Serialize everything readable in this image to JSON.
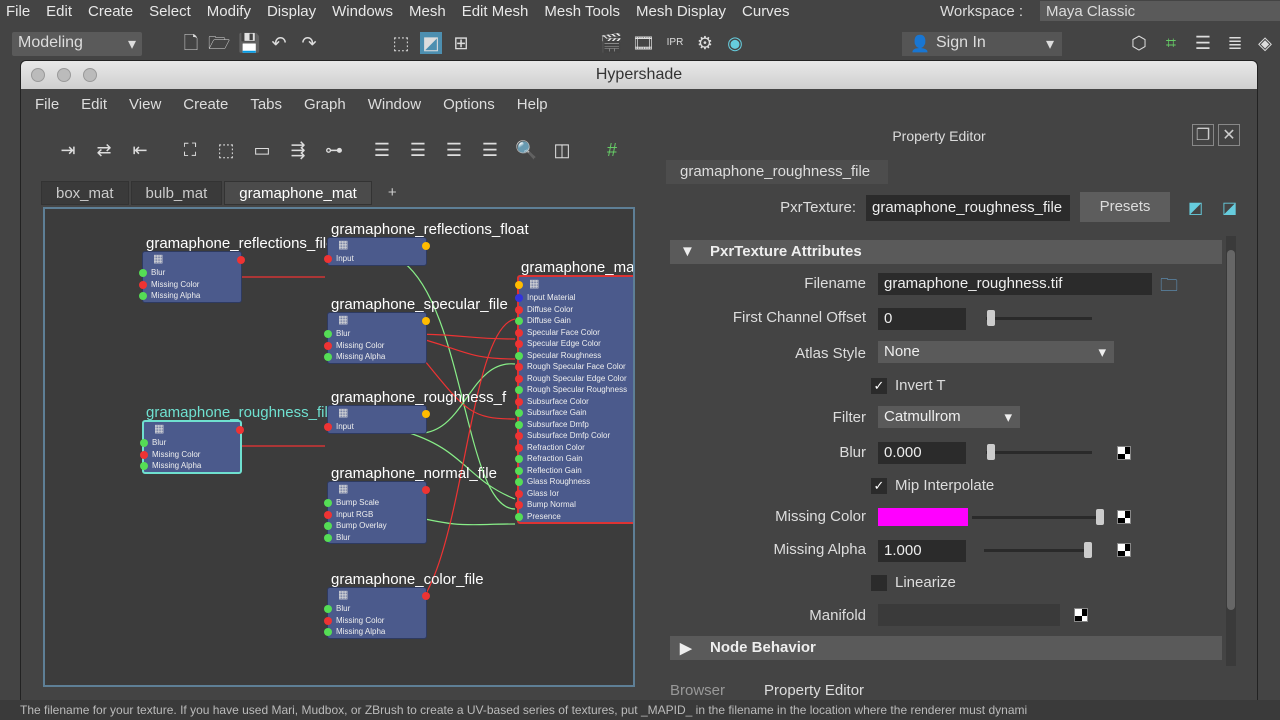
{
  "menubar": [
    "File",
    "Edit",
    "Create",
    "Select",
    "Modify",
    "Display",
    "Windows",
    "Mesh",
    "Edit Mesh",
    "Mesh Tools",
    "Mesh Display",
    "Curves"
  ],
  "workspace": {
    "label": "Workspace :",
    "value": "Maya Classic"
  },
  "toolbar": {
    "mode": "Modeling",
    "sign_in": "Sign In"
  },
  "hypershade": {
    "title": "Hypershade",
    "menu": [
      "File",
      "Edit",
      "View",
      "Create",
      "Tabs",
      "Graph",
      "Window",
      "Options",
      "Help"
    ],
    "tabs": [
      "box_mat",
      "bulb_mat",
      "gramaphone_mat",
      "+"
    ],
    "active_tab": 2,
    "nodes": {
      "reflections_file": {
        "title": "gramaphone_reflections_file",
        "rows": [
          "Blur",
          "Missing Color",
          "Missing Alpha"
        ]
      },
      "reflections_float": {
        "title": "gramaphone_reflections_float",
        "rows": [
          "Input"
        ]
      },
      "specular_file": {
        "title": "gramaphone_specular_file",
        "rows": [
          "Blur",
          "Missing Color",
          "Missing Alpha"
        ]
      },
      "roughness_file": {
        "title": "gramaphone_roughness_file",
        "rows": [
          "Blur",
          "Missing Color",
          "Missing Alpha"
        ]
      },
      "roughness_float": {
        "title": "gramaphone_roughness_f",
        "rows": [
          "Input"
        ]
      },
      "normal_file": {
        "title": "gramaphone_normal_file",
        "rows": [
          "Bump Scale",
          "Input RGB",
          "Bump Overlay",
          "Blur"
        ]
      },
      "color_file": {
        "title": "gramaphone_color_file",
        "rows": [
          "Blur",
          "Missing Color",
          "Missing Alpha"
        ]
      },
      "material": {
        "title": "gramaphone_ma",
        "rows": [
          "Input Material",
          "Diffuse Color",
          "Diffuse Gain",
          "Specular Face Color",
          "Specular Edge Color",
          "Specular Roughness",
          "Rough Specular Face Color",
          "Rough Specular Edge Color",
          "Rough Specular Roughness",
          "Subsurface Color",
          "Subsurface Gain",
          "Subsurface Dmfp",
          "Subsurface Dmfp Color",
          "Refraction Color",
          "Refraction Gain",
          "Reflection Gain",
          "Glass Roughness",
          "Glass Ior",
          "Bump Normal",
          "Presence"
        ]
      }
    },
    "selected_color": "#6fe0d0"
  },
  "property_editor": {
    "title": "Property Editor",
    "node_tab": "gramaphone_roughness_file",
    "type_label": "PxrTexture:",
    "type_value": "gramaphone_roughness_file",
    "presets": "Presets",
    "section": "PxrTexture Attributes",
    "filename_label": "Filename",
    "filename": "gramaphone_roughness.tif",
    "first_channel_label": "First Channel Offset",
    "first_channel": "0",
    "atlas_label": "Atlas Style",
    "atlas": "None",
    "invert_t": "Invert T",
    "invert_t_checked": true,
    "filter_label": "Filter",
    "filter": "Catmullrom",
    "blur_label": "Blur",
    "blur": "0.000",
    "mip_label": "Mip Interpolate",
    "mip_checked": true,
    "missing_color_label": "Missing Color",
    "missing_color": "#ff00ff",
    "missing_alpha_label": "Missing Alpha",
    "missing_alpha": "1.000",
    "linearize": "Linearize",
    "linearize_checked": false,
    "manifold_label": "Manifold",
    "node_behavior": "Node Behavior"
  },
  "bottom_tabs": [
    "Browser",
    "Property Editor"
  ],
  "status": "The filename for your texture. If you have used Mari, Mudbox, or ZBrush to create a UV-based series of textures, put _MAPID_ in the filename in the location where the renderer must dynami"
}
